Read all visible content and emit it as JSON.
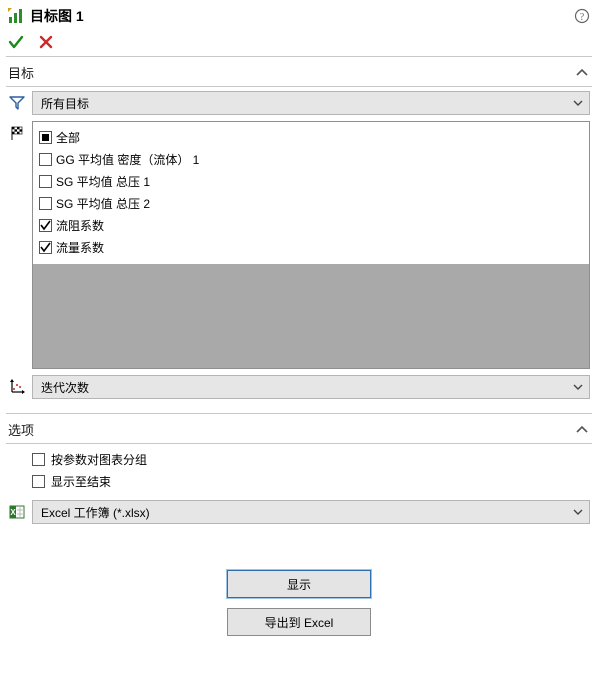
{
  "title": "目标图 1",
  "sections": {
    "goals": {
      "header": "目标",
      "filter_combo": "所有目标",
      "items": [
        {
          "label": "全部",
          "state": "all"
        },
        {
          "label": "GG 平均值 密度（流体） 1",
          "state": "unchecked"
        },
        {
          "label": "SG 平均值 总压 1",
          "state": "unchecked"
        },
        {
          "label": "SG 平均值 总压 2",
          "state": "unchecked"
        },
        {
          "label": "流阻系数",
          "state": "checked"
        },
        {
          "label": "流量系数",
          "state": "checked"
        }
      ],
      "xaxis_combo": "迭代次数"
    },
    "options": {
      "header": "选项",
      "group_by_param": "按参数对图表分组",
      "show_to_end": "显示至结束",
      "export_format": "Excel 工作簿 (*.xlsx)"
    }
  },
  "buttons": {
    "show": "显示",
    "export": "导出到 Excel"
  }
}
